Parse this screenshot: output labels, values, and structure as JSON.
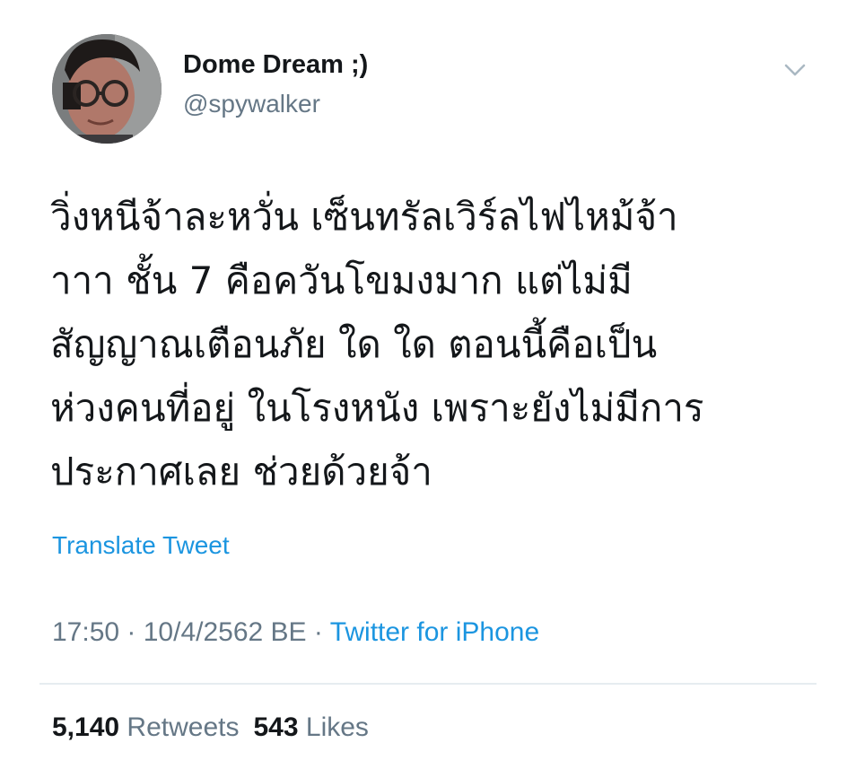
{
  "author": {
    "display_name": "Dome Dream ;)",
    "handle": "@spywalker"
  },
  "icons": {
    "avatar": "profile-photo",
    "menu": "chevron-down-icon"
  },
  "tweet": {
    "lines": [
      "วิ่งหนีจ้าละหวั่น เซ็นทรัลเวิร์ลไฟไหม้จ้า",
      "าาา ชั้น 7 คือควันโขมงมาก แต่ไม่มี",
      "สัญญาณเตือนภัย ใด ใด ตอนนี้คือเป็น",
      "ห่วงคนที่อยู่ ในโรงหนัง เพราะยังไม่มีการ",
      "ประกาศเลย ช่วยด้วยจ้า"
    ],
    "translate_label": "Translate Tweet",
    "time": "17:50",
    "separator": " · ",
    "date": "10/4/2562 BE",
    "source": "Twitter for iPhone"
  },
  "stats": {
    "retweets_count": "5,140",
    "retweets_label": "Retweets",
    "likes_count": "543",
    "likes_label": "Likes"
  },
  "colors": {
    "link": "#1b95e0",
    "secondary": "#657786",
    "primary": "#14171a",
    "divider": "#e6ecf0"
  }
}
